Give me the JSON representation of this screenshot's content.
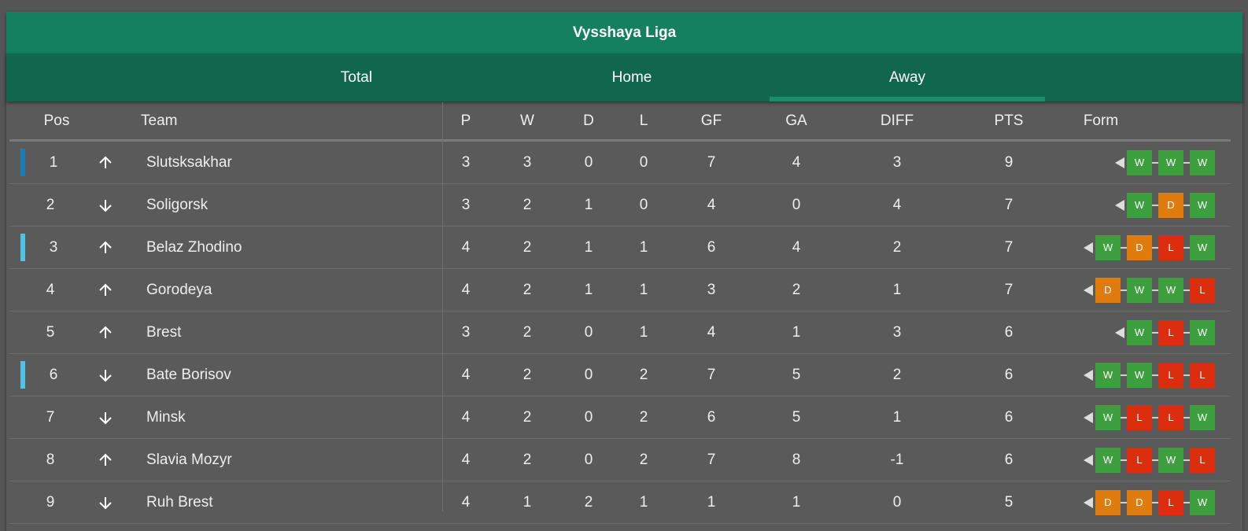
{
  "league": {
    "title": "Vysshaya Liga"
  },
  "tabs": [
    {
      "label": "Total",
      "active": false
    },
    {
      "label": "Home",
      "active": false
    },
    {
      "label": "Away",
      "active": true
    }
  ],
  "columns": [
    "Pos",
    "Team",
    "P",
    "W",
    "D",
    "L",
    "GF",
    "GA",
    "DIFF",
    "PTS",
    "Form"
  ],
  "colors": {
    "W": "#3e9f3e",
    "D": "#e07b0e",
    "L": "#dd2d0f",
    "marker_dark": "#1b7cb8",
    "marker_light": "#4fc3e6"
  },
  "rows": [
    {
      "pos": "1",
      "trend": "up",
      "marker": "marker_dark",
      "team": "Slutsksakhar",
      "p": "3",
      "w": "3",
      "d": "0",
      "l": "0",
      "gf": "7",
      "ga": "4",
      "diff": "3",
      "pts": "9",
      "form": [
        "W",
        "W",
        "W"
      ]
    },
    {
      "pos": "2",
      "trend": "down",
      "marker": null,
      "team": "Soligorsk",
      "p": "3",
      "w": "2",
      "d": "1",
      "l": "0",
      "gf": "4",
      "ga": "0",
      "diff": "4",
      "pts": "7",
      "form": [
        "W",
        "D",
        "W"
      ]
    },
    {
      "pos": "3",
      "trend": "up",
      "marker": "marker_light",
      "team": "Belaz Zhodino",
      "p": "4",
      "w": "2",
      "d": "1",
      "l": "1",
      "gf": "6",
      "ga": "4",
      "diff": "2",
      "pts": "7",
      "form": [
        "W",
        "D",
        "L",
        "W"
      ]
    },
    {
      "pos": "4",
      "trend": "up",
      "marker": null,
      "team": "Gorodeya",
      "p": "4",
      "w": "2",
      "d": "1",
      "l": "1",
      "gf": "3",
      "ga": "2",
      "diff": "1",
      "pts": "7",
      "form": [
        "D",
        "W",
        "W",
        "L"
      ]
    },
    {
      "pos": "5",
      "trend": "up",
      "marker": null,
      "team": "Brest",
      "p": "3",
      "w": "2",
      "d": "0",
      "l": "1",
      "gf": "4",
      "ga": "1",
      "diff": "3",
      "pts": "6",
      "form": [
        "W",
        "L",
        "W"
      ]
    },
    {
      "pos": "6",
      "trend": "down",
      "marker": "marker_light",
      "team": "Bate Borisov",
      "p": "4",
      "w": "2",
      "d": "0",
      "l": "2",
      "gf": "7",
      "ga": "5",
      "diff": "2",
      "pts": "6",
      "form": [
        "W",
        "W",
        "L",
        "L"
      ]
    },
    {
      "pos": "7",
      "trend": "down",
      "marker": null,
      "team": "Minsk",
      "p": "4",
      "w": "2",
      "d": "0",
      "l": "2",
      "gf": "6",
      "ga": "5",
      "diff": "1",
      "pts": "6",
      "form": [
        "W",
        "L",
        "L",
        "W"
      ]
    },
    {
      "pos": "8",
      "trend": "up",
      "marker": null,
      "team": "Slavia Mozyr",
      "p": "4",
      "w": "2",
      "d": "0",
      "l": "2",
      "gf": "7",
      "ga": "8",
      "diff": "-1",
      "pts": "6",
      "form": [
        "W",
        "L",
        "W",
        "L"
      ]
    },
    {
      "pos": "9",
      "trend": "down",
      "marker": null,
      "team": "Ruh Brest",
      "p": "4",
      "w": "1",
      "d": "2",
      "l": "1",
      "gf": "1",
      "ga": "1",
      "diff": "0",
      "pts": "5",
      "form": [
        "D",
        "D",
        "L",
        "W"
      ]
    }
  ]
}
